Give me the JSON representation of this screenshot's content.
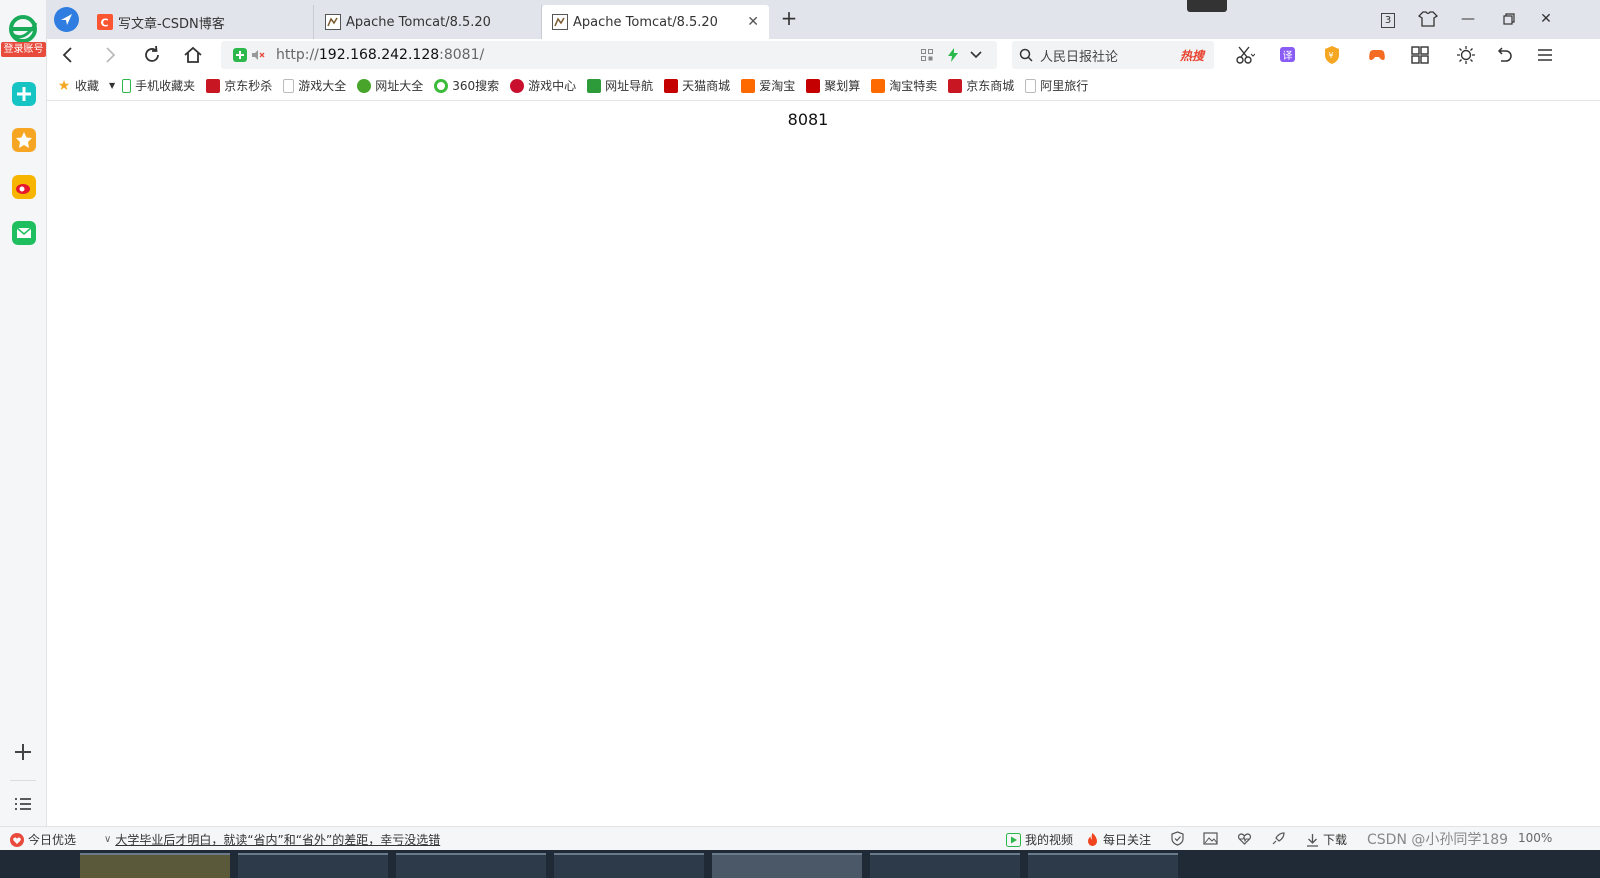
{
  "sidebar": {
    "login_label": "登录账号"
  },
  "tabs": [
    {
      "label": "写文章-CSDN博客",
      "favicon": "csdn-icon"
    },
    {
      "label": "Apache Tomcat/8.5.20",
      "favicon": "tomcat-icon"
    },
    {
      "label": "Apache Tomcat/8.5.20",
      "favicon": "tomcat-icon",
      "active": true
    }
  ],
  "tab_count_badge": "3",
  "address": {
    "scheme": "http://",
    "host": "192.168.242.128",
    "rest": ":8081/"
  },
  "search": {
    "text": "人民日报社论",
    "hot_label": "热搜"
  },
  "bookmarks": [
    {
      "label": "收藏",
      "icon": "star-icon",
      "color": "#f5a623"
    },
    {
      "label": "手机收藏夹",
      "icon": "phone-icon",
      "color": "#2db84c"
    },
    {
      "label": "京东秒杀",
      "icon": "jd-icon",
      "color": "#c91623"
    },
    {
      "label": "游戏大全",
      "icon": "page-icon",
      "color": "#bbbbbb"
    },
    {
      "label": "网址大全",
      "icon": "plus-circle-icon",
      "color": "#48a42b"
    },
    {
      "label": "360搜索",
      "icon": "so-icon",
      "color": "#3dbb3a"
    },
    {
      "label": "游戏中心",
      "icon": "game-icon",
      "color": "#c8102e"
    },
    {
      "label": "网址导航",
      "icon": "hao-icon",
      "color": "#2e9b3a"
    },
    {
      "label": "天猫商城",
      "icon": "tmall-icon",
      "color": "#c40000"
    },
    {
      "label": "爱淘宝",
      "icon": "taobao-icon",
      "color": "#ff6a00"
    },
    {
      "label": "聚划算",
      "icon": "juhuasuan-icon",
      "color": "#c40000"
    },
    {
      "label": "淘宝特卖",
      "icon": "taobao-icon",
      "color": "#ff6a00"
    },
    {
      "label": "京东商城",
      "icon": "jd-icon",
      "color": "#c91623"
    },
    {
      "label": "阿里旅行",
      "icon": "page-icon",
      "color": "#bbbbbb"
    }
  ],
  "page": {
    "body_text": "8081"
  },
  "statusbar": {
    "today_label": "今日优选",
    "headline": "大学毕业后才明白，就读“省内”和“省外”的差距，幸亏没选错",
    "my_video": "我的视频",
    "daily_follow": "每日关注",
    "download": "下载",
    "zoom": "100%",
    "watermark": "CSDN @小孙同学189"
  }
}
